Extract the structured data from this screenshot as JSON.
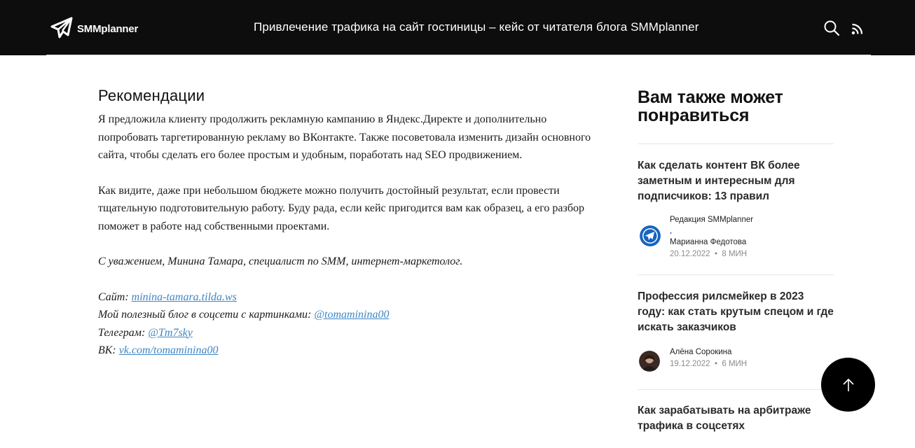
{
  "header": {
    "logo_text": "SMMplanner",
    "title": "Привлечение трафика на сайт гостиницы – кейс от читателя блога SMMplanner"
  },
  "article": {
    "heading": "Рекомендации",
    "paragraphs": [
      "Я предложила клиенту продолжить рекламную кампанию в Яндекс.Директе и дополнительно попробовать таргетированную рекламу во ВКонтакте. Также посоветовала изменить дизайн основного сайта, чтобы сделать его более простым и удобным, поработать над SEO продвижением.",
      "Как видите, даже при небольшом бюджете можно получить достойный результат, если провести тщательную подготовительную работу. Буду рада, если кейс пригодится вам как образец, а его разбор поможет в работе над собственными проектами.",
      "С уважением, Минина Тамара, специалист по SMM, интернет-маркетолог."
    ],
    "contacts": [
      {
        "label": "Сайт: ",
        "link": "minina-tamara.tilda.ws"
      },
      {
        "label": "Мой полезный блог в соцсети с картинками: ",
        "link": "@tomaminina00"
      },
      {
        "label": "Телеграм: ",
        "link": "@Tm7sky"
      },
      {
        "label": "ВК: ",
        "link": "vk.com/tomaminina00"
      }
    ]
  },
  "sidebar": {
    "heading": "Вам также может понравиться",
    "cards": [
      {
        "title": "Как сделать контент ВК более заметным и интересным для подписчиков: 13 правил",
        "author1": "Редакция SMMplanner",
        "separator": ",",
        "author2": "Марианна Федотова",
        "date": "20.12.2022",
        "read_time": "8 МИН"
      },
      {
        "title": "Профессия рилсмейкер в 2023 году: как стать крутым спецом и где искать заказчиков",
        "author1": "Алёна Сорокина",
        "date": "19.12.2022",
        "read_time": "6 МИН"
      },
      {
        "title": "Как зарабатывать на арбитраже трафика в соцсетях"
      }
    ],
    "dot": "•"
  },
  "colors": {
    "header_bg": "#0d0d0d",
    "link": "#3d86c6",
    "brand_blue": "#1565c0"
  }
}
